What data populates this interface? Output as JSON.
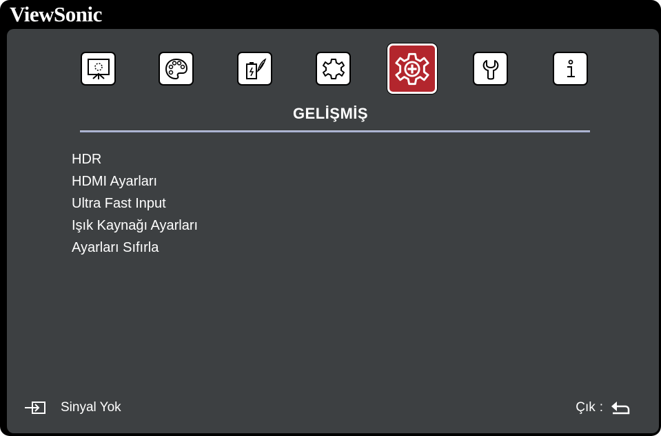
{
  "brand": "ViewSonic",
  "tabs": [
    {
      "name": "Ekran",
      "icon": "screen-icon",
      "active": false
    },
    {
      "name": "Görüntü",
      "icon": "palette-icon",
      "active": false
    },
    {
      "name": "Güç Yönetimi",
      "icon": "power-icon",
      "active": false
    },
    {
      "name": "Temel",
      "icon": "gear-icon",
      "active": false
    },
    {
      "name": "Gelişmiş",
      "icon": "gear-plus-icon",
      "active": true
    },
    {
      "name": "Sistem",
      "icon": "wrench-icon",
      "active": false
    },
    {
      "name": "Bilgi",
      "icon": "info-icon",
      "active": false
    }
  ],
  "section_title": "GELİŞMİŞ",
  "menu_items": [
    "HDR",
    "HDMI Ayarları",
    "Ultra Fast Input",
    "Işık Kaynağı Ayarları",
    "Ayarları Sıfırla"
  ],
  "footer": {
    "signal_text": "Sinyal Yok",
    "signal_icon": "input-icon",
    "exit_label": "Çık",
    "exit_separator": ":",
    "exit_icon": "return-icon"
  },
  "colors": {
    "frame": "#000000",
    "panel": "#3d4042",
    "active_tab": "#b3262d",
    "text": "#ffffff",
    "divider": "#aab3d2"
  }
}
